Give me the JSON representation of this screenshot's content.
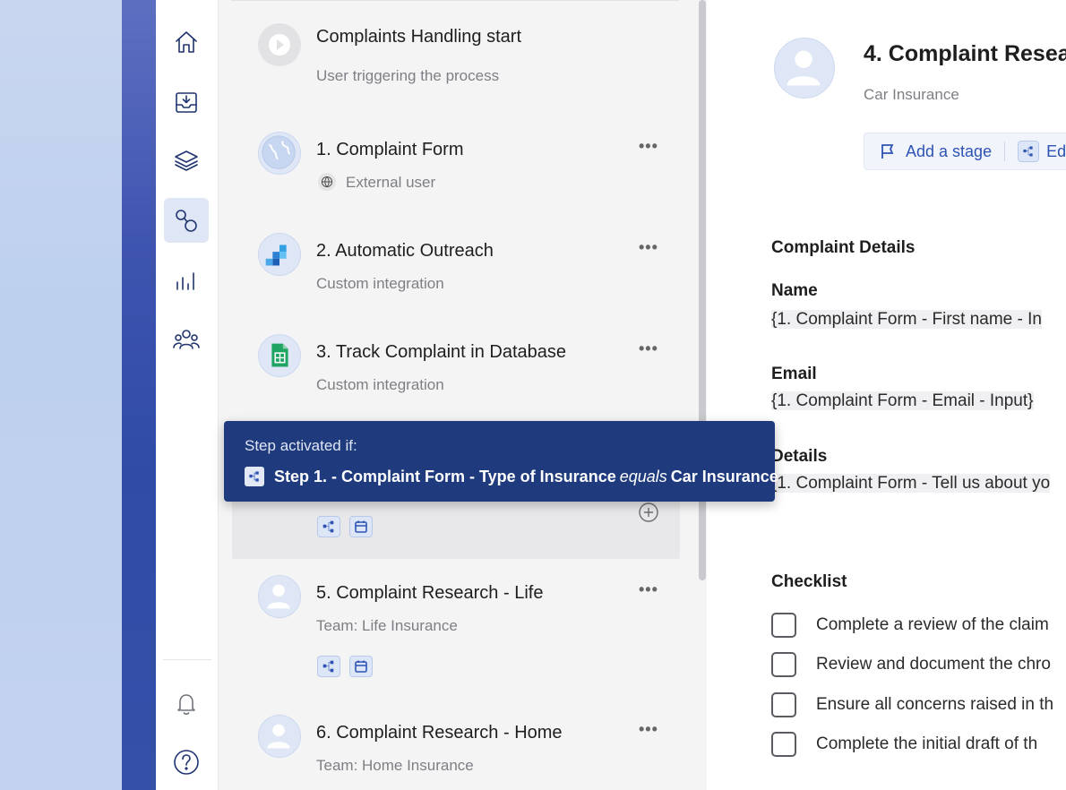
{
  "rail": {
    "items": [
      {
        "name": "home-icon",
        "active": false
      },
      {
        "name": "inbox-icon",
        "active": false
      },
      {
        "name": "layers-icon",
        "active": false
      },
      {
        "name": "process-icon",
        "active": true
      },
      {
        "name": "analytics-icon",
        "active": false
      },
      {
        "name": "team-icon",
        "active": false
      }
    ],
    "bottom": [
      "bell-icon",
      "help-icon"
    ]
  },
  "steps": [
    {
      "title": "Complaints Handling start",
      "subtitle": "User triggering the process",
      "icon": "play-icon"
    },
    {
      "title": "1. Complaint Form",
      "subtitle": "External user",
      "icon": "globe-icon",
      "menu": "•••"
    },
    {
      "title": "2. Automatic Outreach",
      "subtitle": "Custom integration",
      "icon": "integration-icon",
      "menu": "•••"
    },
    {
      "title": "3. Track Complaint in Database",
      "subtitle": "Custom integration",
      "icon": "sheets-icon",
      "menu": "•••"
    },
    {
      "title": "5. Complaint Research - Life",
      "subtitle": "Team: Life Insurance",
      "icon": "team-avatar-icon",
      "menu": "•••"
    },
    {
      "title": "6. Complaint Research - Home",
      "subtitle": "Team: Home Insurance",
      "icon": "team-avatar-icon",
      "menu": "•••"
    }
  ],
  "tooltip": {
    "label": "Step activated if:",
    "condition_subject": "Step 1. - Complaint Form - Type of Insurance",
    "condition_operator": "equals",
    "condition_value": "Car Insurance"
  },
  "detail": {
    "title": "4. Complaint Resear",
    "subtitle": "Car Insurance",
    "actions": {
      "add_stage": "Add a stage",
      "edit": "Ed"
    },
    "section_title": "Complaint Details",
    "fields": [
      {
        "label": "Name",
        "value": "{1. Complaint Form - First name - In"
      },
      {
        "label": "Email",
        "value": "{1. Complaint Form - Email - Input}"
      },
      {
        "label": "Details",
        "value": "{1. Complaint Form - Tell us about yo"
      }
    ],
    "checklist_title": "Checklist",
    "checklist": [
      "Complete a review of the claim",
      "Review and document the chro",
      "Ensure all concerns raised in th",
      "Complete the initial draft of th"
    ]
  },
  "colors": {
    "accent": "#2d53b4",
    "tooltip_bg": "#1f3b7d",
    "rail_active": "#dfe6f5",
    "list_bg": "#f4f4f5"
  }
}
